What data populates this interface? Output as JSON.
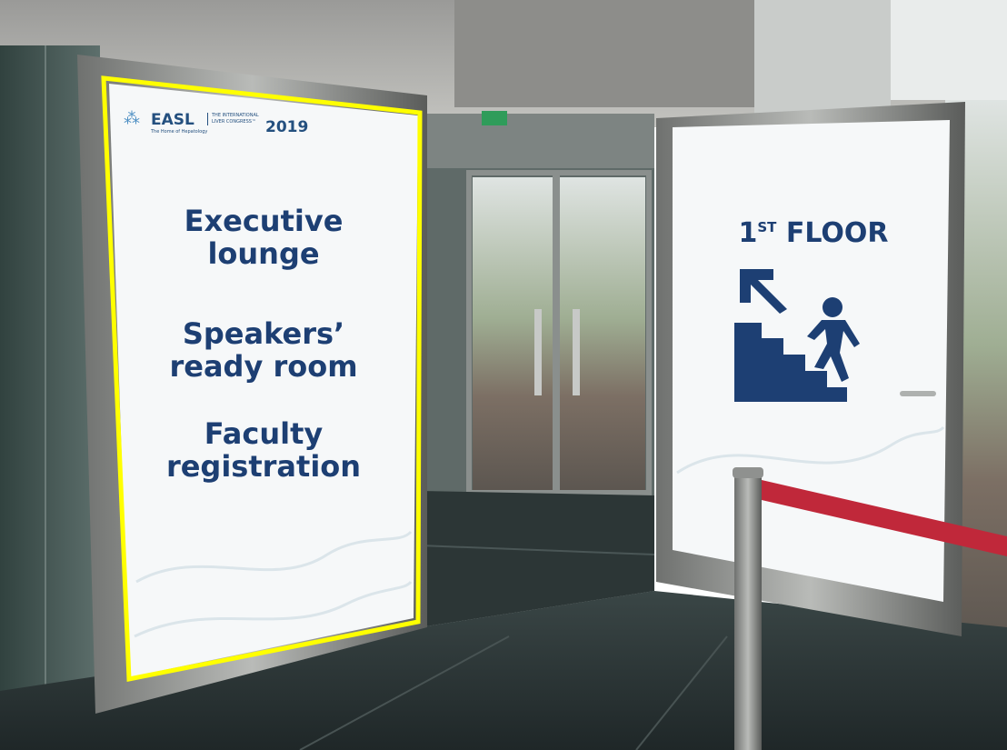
{
  "left_sign": {
    "logo_text": "EASL",
    "logo_tagline": "The Home of Hepatology",
    "congress_text": "THE INTERNATIONAL LIVER CONGRESS™",
    "congress_year": "2019",
    "line1": "Executive",
    "line2": "lounge",
    "line3": "Speakers’",
    "line4": "ready room",
    "line5": "Faculty",
    "line6": "registration"
  },
  "right_sign": {
    "floor_number": "1",
    "floor_suffix": "ST",
    "floor_word": "FLOOR",
    "icon": "stairs-up-left-icon"
  },
  "colors": {
    "sign_text": "#1d3f73",
    "highlight_frame": "#ffff00",
    "barrier_rope": "#c0283a"
  }
}
